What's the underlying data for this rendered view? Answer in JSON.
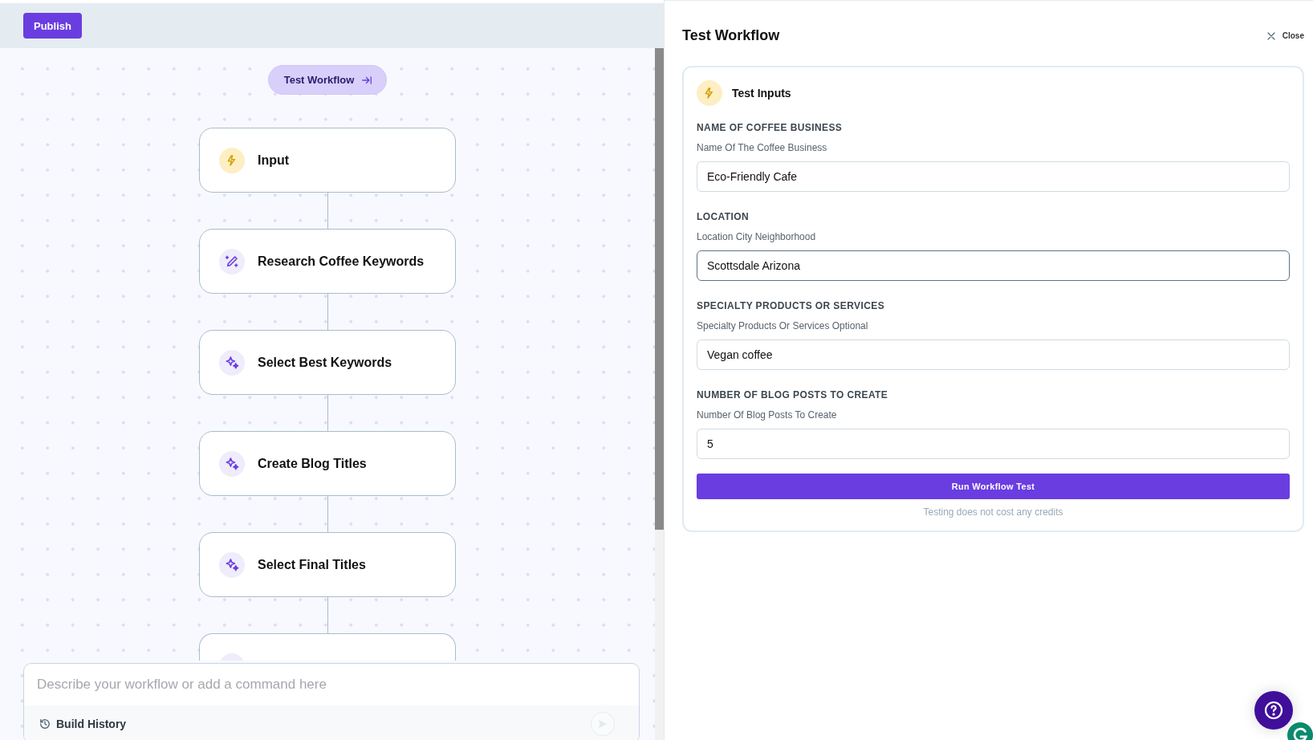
{
  "toolbar": {
    "publish": "Publish"
  },
  "canvas": {
    "test_button": "Test Workflow",
    "nodes": [
      {
        "label": "Input",
        "kind": "input"
      },
      {
        "label": "Research Coffee Keywords",
        "kind": "edit"
      },
      {
        "label": "Select Best Keywords",
        "kind": "ai"
      },
      {
        "label": "Create Blog Titles",
        "kind": "ai"
      },
      {
        "label": "Select Final Titles",
        "kind": "ai"
      },
      {
        "kind": "ai"
      }
    ]
  },
  "composer": {
    "placeholder": "Describe your workflow or add a command here",
    "history": "Build History"
  },
  "panel": {
    "title": "Test Workflow",
    "close": "Close",
    "card_title": "Test Inputs",
    "fields": [
      {
        "label": "NAME OF COFFEE BUSINESS",
        "hint": "Name Of The Coffee Business",
        "value": "Eco-Friendly Cafe",
        "focused": false
      },
      {
        "label": "LOCATION",
        "hint": "Location City Neighborhood",
        "value": "Scottsdale Arizona",
        "focused": true
      },
      {
        "label": "SPECIALTY PRODUCTS OR SERVICES",
        "hint": "Specialty Products Or Services Optional",
        "value": "Vegan coffee",
        "focused": false
      },
      {
        "label": "NUMBER OF BLOG POSTS TO CREATE",
        "hint": "Number Of Blog Posts To Create",
        "value": "5",
        "focused": false
      }
    ],
    "run": "Run Workflow Test",
    "note": "Testing does not cost any credits"
  }
}
